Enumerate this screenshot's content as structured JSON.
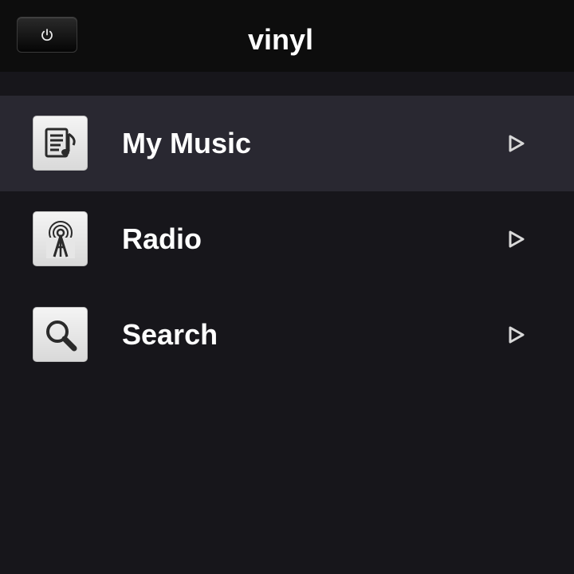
{
  "header": {
    "title": "vinyl",
    "power_icon": "power-icon"
  },
  "menu": {
    "items": [
      {
        "label": "My Music",
        "icon": "music-note-document-icon",
        "selected": true
      },
      {
        "label": "Radio",
        "icon": "radio-tower-icon",
        "selected": false
      },
      {
        "label": "Search",
        "icon": "magnifier-icon",
        "selected": false
      }
    ],
    "arrow_icon": "chevron-right-outline-icon"
  },
  "colors": {
    "background": "#17161b",
    "header_background": "#0d0d0d",
    "selected_row": "#292831",
    "text": "#ffffff",
    "icon_tile": "#e6e6e6",
    "arrow": "#d8d8d8"
  }
}
